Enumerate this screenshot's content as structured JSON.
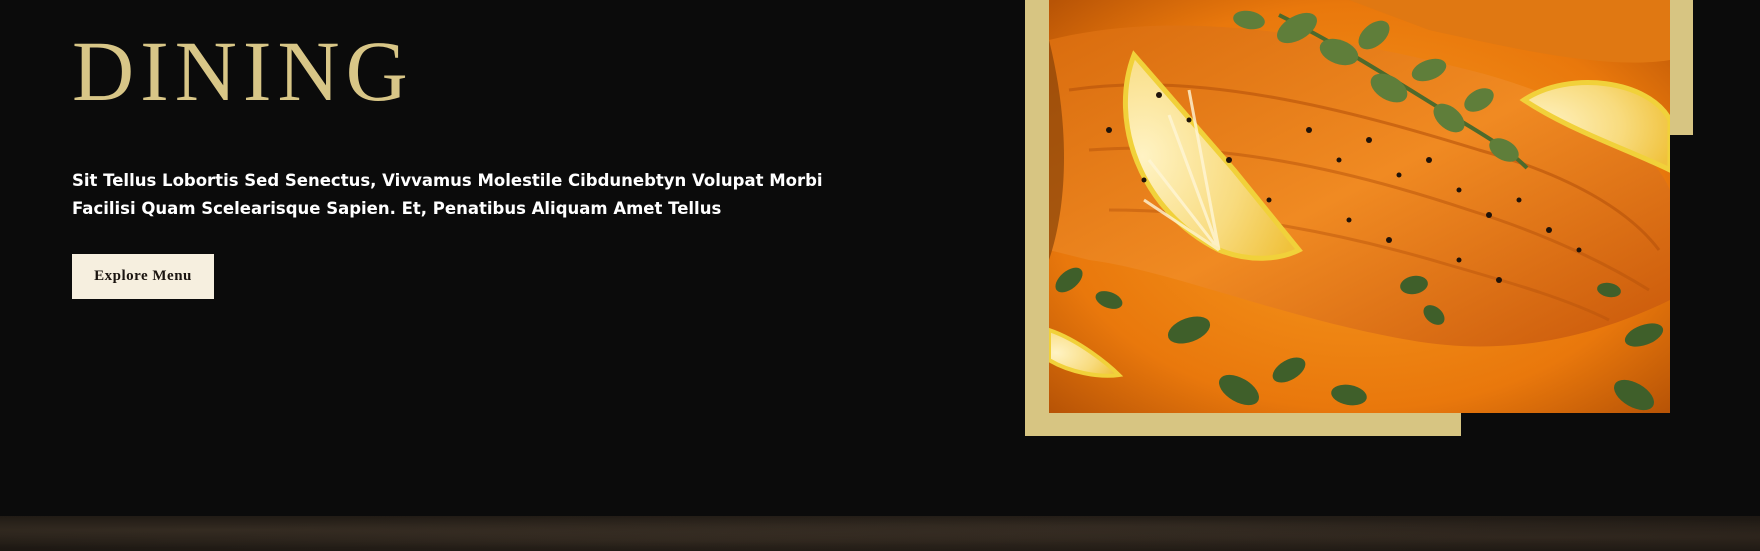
{
  "hero": {
    "title": "DINING",
    "description": "Sit Tellus Lobortis Sed Senectus, Vivvamus Molestile Cibdunebtyn Volupat Morbi Facilisi Quam Scelearisque Sapien. Et, Penatibus Aliquam Amet Tellus",
    "cta_label": "Explore Menu"
  },
  "image": {
    "alt": "Seared salmon in orange sauce with lemon slices and oregano",
    "icon": "salmon-dish-photo"
  },
  "colors": {
    "background": "#0b0b0b",
    "gold": "#d7c582",
    "heading": "#d8c687",
    "text": "#ffffff",
    "button_bg": "#f6efdf",
    "button_text": "#1a1410"
  }
}
